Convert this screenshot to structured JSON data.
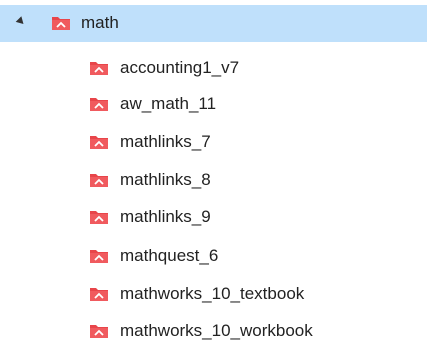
{
  "tree": {
    "root": {
      "label": "math",
      "expanded": true,
      "icon": "folder-icon"
    },
    "children": [
      {
        "label": "accounting1_v7",
        "icon": "folder-icon"
      },
      {
        "label": "aw_math_11",
        "icon": "folder-icon"
      },
      {
        "label": "mathlinks_7",
        "icon": "folder-icon"
      },
      {
        "label": "mathlinks_8",
        "icon": "folder-icon"
      },
      {
        "label": "mathlinks_9",
        "icon": "folder-icon"
      },
      {
        "label": "mathquest_6",
        "icon": "folder-icon"
      },
      {
        "label": "mathworks_10_textbook",
        "icon": "folder-icon"
      },
      {
        "label": "mathworks_10_workbook",
        "icon": "folder-icon"
      }
    ]
  },
  "colors": {
    "selected_row_bg": "#bfe0fb",
    "folder_red": "#e8454a",
    "text": "#222222"
  }
}
